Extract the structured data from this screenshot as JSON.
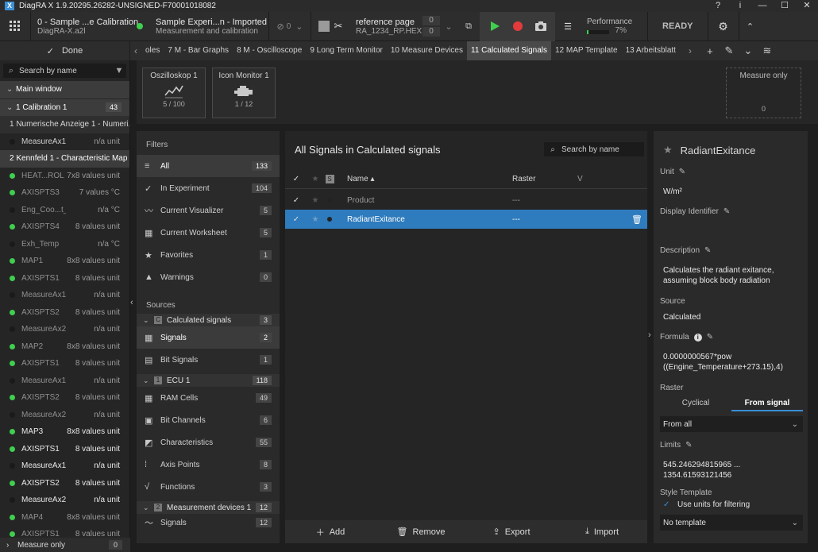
{
  "window": {
    "title": "DiagRA X 1.9.20295.26282-UNSIGNED-F70001018082",
    "buttons": [
      "?",
      "i",
      "—",
      "☐",
      "✕"
    ]
  },
  "toolbar": {
    "project_line1": "0 - Sample ...e Calibration",
    "project_line2": "DiagRA-X.a2l",
    "experiment_line1": "Sample Experi...n - Imported",
    "experiment_line2": "Measurement and calibration",
    "link_count": "0",
    "refpage_label": "reference page",
    "refpage_file": "RA_1234_RP.HEX",
    "refpage_counter_top": "0",
    "refpage_counter_bottom": "0",
    "performance_label": "Performance",
    "performance_value": "7%",
    "performance_fraction": 0.07,
    "status": "READY",
    "accent_green": "#3fcf4f",
    "record_red": "#e23b3b"
  },
  "tabs": {
    "done_label": "Done",
    "items": [
      "oles",
      "7  M - Bar Graphs",
      "8  M - Oscilloscope",
      "9  Long Term Monitor",
      "10 Measure Devices",
      "11 Calculated Signals",
      "12 MAP Template",
      "13 Arbeitsblatt"
    ],
    "active_index": 5
  },
  "left": {
    "search_placeholder": "Search by name",
    "main_window": "Main window",
    "calibration": "1  Calibration 1",
    "calibration_count": "43",
    "numeric_display": "1  Numerische Anzeige 1 - Numeri...",
    "measure_ax1_top": "MeasureAx1",
    "measure_ax1_top_unit": "n/a unit",
    "kennfeld": "2  Kennfeld 1 - Characteristic Map",
    "rows": [
      {
        "name": "HEAT...ROL",
        "val": "7x8 values unit",
        "status": "green",
        "style": "dim"
      },
      {
        "name": "AXISPTS3",
        "val": "7 values °C",
        "status": "green",
        "style": "dim"
      },
      {
        "name": "Eng_Coo...t_Temp",
        "val": "n/a °C",
        "status": "none",
        "style": "dim"
      },
      {
        "name": "AXISPTS4",
        "val": "8 values unit",
        "status": "green",
        "style": "dim"
      },
      {
        "name": "Exh_Temp",
        "val": "n/a °C",
        "status": "none",
        "style": "dim"
      },
      {
        "name": "MAP1",
        "val": "8x8 values unit",
        "status": "green",
        "style": "dim"
      },
      {
        "name": "AXISPTS1",
        "val": "8 values unit",
        "status": "green",
        "style": "dim"
      },
      {
        "name": "MeasureAx1",
        "val": "n/a unit",
        "status": "none",
        "style": "dim"
      },
      {
        "name": "AXISPTS2",
        "val": "8 values unit",
        "status": "green",
        "style": "dim"
      },
      {
        "name": "MeasureAx2",
        "val": "n/a unit",
        "status": "none",
        "style": "dim"
      },
      {
        "name": "MAP2",
        "val": "8x8 values unit",
        "status": "green",
        "style": "dim"
      },
      {
        "name": "AXISPTS1",
        "val": "8 values unit",
        "status": "green",
        "style": "dim"
      },
      {
        "name": "MeasureAx1",
        "val": "n/a unit",
        "status": "none",
        "style": "dim"
      },
      {
        "name": "AXISPTS2",
        "val": "8 values unit",
        "status": "green",
        "style": "dim"
      },
      {
        "name": "MeasureAx2",
        "val": "n/a unit",
        "status": "none",
        "style": "dim"
      },
      {
        "name": "MAP3",
        "val": "8x8 values unit",
        "status": "green",
        "style": "bright"
      },
      {
        "name": "AXISPTS1",
        "val": "8 values unit",
        "status": "green",
        "style": "bright"
      },
      {
        "name": "MeasureAx1",
        "val": "n/a unit",
        "status": "none",
        "style": "bright"
      },
      {
        "name": "AXISPTS2",
        "val": "8 values unit",
        "status": "green",
        "style": "bright"
      },
      {
        "name": "MeasureAx2",
        "val": "n/a unit",
        "status": "none",
        "style": "bright"
      },
      {
        "name": "MAP4",
        "val": "8x8 values unit",
        "status": "green",
        "style": "dim"
      },
      {
        "name": "AXISPTS1",
        "val": "8 values unit",
        "status": "green",
        "style": "dim"
      }
    ],
    "bottom_label": "Measure only",
    "bottom_count": "0"
  },
  "visualizers": {
    "cards": [
      {
        "title": "Oszilloskop 1",
        "count": "5 / 100"
      },
      {
        "title": "Icon Monitor 1",
        "count": "1 / 12"
      }
    ],
    "measure_only_title": "Measure only",
    "measure_only_count": "0"
  },
  "filters": {
    "title": "Filters",
    "items": [
      {
        "label": "All",
        "count": "133",
        "icon": "≡"
      },
      {
        "label": "In Experiment",
        "count": "104",
        "icon": "✓"
      },
      {
        "label": "Current Visualizer",
        "count": "5",
        "icon": "〰"
      },
      {
        "label": "Current Worksheet",
        "count": "5",
        "icon": "▦"
      },
      {
        "label": "Favorites",
        "count": "1",
        "icon": "★"
      },
      {
        "label": "Warnings",
        "count": "0",
        "icon": "▲"
      }
    ],
    "sources_title": "Sources",
    "calc_group": "Calculated signals",
    "calc_group_count": "3",
    "calc_items": [
      {
        "label": "Signals",
        "count": "2",
        "icon": "▦"
      },
      {
        "label": "Bit Signals",
        "count": "1",
        "icon": "▤"
      }
    ],
    "ecu_group": "ECU 1",
    "ecu_group_count": "118",
    "ecu_items": [
      {
        "label": "RAM Cells",
        "count": "49",
        "icon": "▦"
      },
      {
        "label": "Bit Channels",
        "count": "6",
        "icon": "▣"
      },
      {
        "label": "Characteristics",
        "count": "55",
        "icon": "◩"
      },
      {
        "label": "Axis Points",
        "count": "8",
        "icon": "⁞"
      },
      {
        "label": "Functions",
        "count": "3",
        "icon": "√"
      }
    ],
    "md_group": "Measurement devices 1",
    "md_group_count": "12",
    "md_items": [
      {
        "label": "Signals",
        "count": "12",
        "icon": "〜"
      }
    ]
  },
  "signals": {
    "title": "All Signals in Calculated signals",
    "search_placeholder": "Search by name",
    "col_name": "Name",
    "col_raster": "Raster",
    "col_v": "V",
    "rows": [
      {
        "name": "Product",
        "raster": "---"
      },
      {
        "name": "RadiantExitance",
        "raster": "---"
      }
    ],
    "selected_index": 1,
    "footer": {
      "add": "Add",
      "remove": "Remove",
      "export": "Export",
      "import": "Import"
    }
  },
  "detail": {
    "title": "RadiantExitance",
    "unit_label": "Unit",
    "unit_value": "W/m²",
    "display_id_label": "Display Identifier",
    "description_label": "Description",
    "description_value": "Calculates the radiant exitance, assuming block body radiation",
    "source_label": "Source",
    "source_value": "Calculated",
    "formula_label": "Formula",
    "formula_value": "0.0000000567*pow ((Engine_Temperature+273.15),4)",
    "raster_label": "Raster",
    "raster_cyclical": "Cyclical",
    "raster_from_signal": "From signal",
    "raster_select": "From all",
    "limits_label": "Limits",
    "limits_value": "545.246294815965 ... 1354.61593121456",
    "style_template_label": "Style Template",
    "use_units_label": "Use units for filtering",
    "template_select": "No template"
  }
}
